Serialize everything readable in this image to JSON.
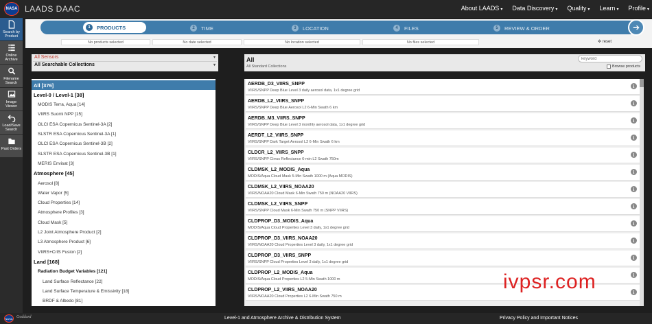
{
  "header": {
    "logo": "NASA",
    "title": "LAADS DAAC",
    "nav": [
      "About LAADS",
      "Data Discovery",
      "Quality",
      "Learn",
      "Profile"
    ]
  },
  "sidebar": [
    {
      "label": "Search by Product",
      "icon": "document-icon",
      "active": true
    },
    {
      "label": "Online Archive",
      "icon": "list-icon"
    },
    {
      "label": "Filename Search",
      "icon": "magnifier-icon"
    },
    {
      "label": "Image Viewer",
      "icon": "image-icon"
    },
    {
      "label": "Load/Save Search",
      "icon": "undo-icon"
    },
    {
      "label": "Past Orders",
      "icon": "folder-icon"
    }
  ],
  "steps": [
    {
      "num": "1",
      "label": "PRODUCTS",
      "selection": "No products selected"
    },
    {
      "num": "2",
      "label": "TIME",
      "selection": "No date selected"
    },
    {
      "num": "3",
      "label": "LOCATION",
      "selection": "No location selected"
    },
    {
      "num": "4",
      "label": "FILES",
      "selection": "No files selected"
    },
    {
      "num": "5",
      "label": "REVIEW & ORDER"
    }
  ],
  "reset_label": "reset",
  "filters": {
    "sensors": "All Sensors",
    "collections": "All Searchable Collections"
  },
  "results_header": {
    "title": "All",
    "subtitle": "All Standard Collections",
    "keyword_placeholder": "keyword",
    "browse_label": "Browse products"
  },
  "categories": [
    {
      "label": "All [376]",
      "level": "active"
    },
    {
      "label": "Level-0 / Level-1 [38]",
      "level": "level0"
    },
    {
      "label": "MODIS Terra, Aqua [14]",
      "level": "level1"
    },
    {
      "label": "VIIRS Suomi NPP [15]",
      "level": "level1"
    },
    {
      "label": "OLCI ESA Copernicus Sentinel-3A [2]",
      "level": "level1"
    },
    {
      "label": "SLSTR ESA Copernicus Sentinel-3A [1]",
      "level": "level1"
    },
    {
      "label": "OLCI ESA Copernicus Sentinel-3B [2]",
      "level": "level1"
    },
    {
      "label": "SLSTR ESA Copernicus Sentinel-3B [1]",
      "level": "level1"
    },
    {
      "label": "MERIS Envisat [3]",
      "level": "level1"
    },
    {
      "label": "Atmosphere [45]",
      "level": "level0"
    },
    {
      "label": "Aerosol [8]",
      "level": "level1"
    },
    {
      "label": "Water Vapor [5]",
      "level": "level1"
    },
    {
      "label": "Cloud Properties [14]",
      "level": "level1"
    },
    {
      "label": "Atmosphere Profiles [3]",
      "level": "level1"
    },
    {
      "label": "Cloud Mask [5]",
      "level": "level1"
    },
    {
      "label": "L2 Joint Atmosphere Product [2]",
      "level": "level1"
    },
    {
      "label": "L3 Atmosphere Product [6]",
      "level": "level1"
    },
    {
      "label": "VIIRS+CrIS Fusion [2]",
      "level": "level1"
    },
    {
      "label": "Land [168]",
      "level": "level0"
    },
    {
      "label": "Radiation Budget Variables [121]",
      "level": "level1b"
    },
    {
      "label": "Land Surface Reflectance [22]",
      "level": "level2"
    },
    {
      "label": "Land Surface Temperature & Emissivity [18]",
      "level": "level2"
    },
    {
      "label": "BRDF & Albedo [81]",
      "level": "level2"
    }
  ],
  "products": [
    {
      "name": "AERDB_D3_VIIRS_SNPP",
      "desc": "VIIRS/SNPP Deep Blue Level 3 daily aerosol data, 1x1 degree grid"
    },
    {
      "name": "AERDB_L2_VIIRS_SNPP",
      "desc": "VIIRS/SNPP Deep Blue Aerosol L2 6-Min Swath 6 km"
    },
    {
      "name": "AERDB_M3_VIIRS_SNPP",
      "desc": "VIIRS/SNPP Deep Blue Level 3 monthly aerosol data, 1x1 degree grid"
    },
    {
      "name": "AERDT_L2_VIIRS_SNPP",
      "desc": "VIIRS/SNPP Dark Target Aerosol L2 6-Min Swath 6 km"
    },
    {
      "name": "CLDCR_L2_VIIRS_SNPP",
      "desc": "VIIRS/SNPP Cirrus Reflectance 6-min L2 Swath 750m"
    },
    {
      "name": "CLDMSK_L2_MODIS_Aqua",
      "desc": "MODIS/Aqua Cloud Mask 5-Min Swath 1000 m (Aqua MODIS)"
    },
    {
      "name": "CLDMSK_L2_VIIRS_NOAA20",
      "desc": "VIIRS/NOAA20 Cloud Mask 6-Min Swath 750 m (NOAA20 VIIRS)"
    },
    {
      "name": "CLDMSK_L2_VIIRS_SNPP",
      "desc": "VIIRS/SNPP Cloud Mask 6-Min Swath 750 m (SNPP VIIRS)"
    },
    {
      "name": "CLDPROP_D3_MODIS_Aqua",
      "desc": "MODIS/Aqua Cloud Properties Level 3 daily, 1x1 degree grid"
    },
    {
      "name": "CLDPROP_D3_VIIRS_NOAA20",
      "desc": "VIIRS/NOAA20 Cloud Properties Level 3 daily, 1x1 degree grid"
    },
    {
      "name": "CLDPROP_D3_VIIRS_SNPP",
      "desc": "VIIRS/SNPP Cloud Properties Level 3 daily, 1x1 degree grid"
    },
    {
      "name": "CLDPROP_L2_MODIS_Aqua",
      "desc": "MODIS/Aqua Cloud Properties L2 5-Min Swath 1000 m"
    },
    {
      "name": "CLDPROP_L2_VIIRS_NOAA20",
      "desc": "VIIRS/NOAA20 Cloud Properties L2 6-Min Swath 750 m"
    }
  ],
  "watermark": "ivpsr.com",
  "footer": {
    "logo": "NASA",
    "goddard": "Goddard",
    "center": "Level-1 and Atmosphere Archive & Distribution System",
    "right": "Privacy Policy and Important Notices"
  }
}
